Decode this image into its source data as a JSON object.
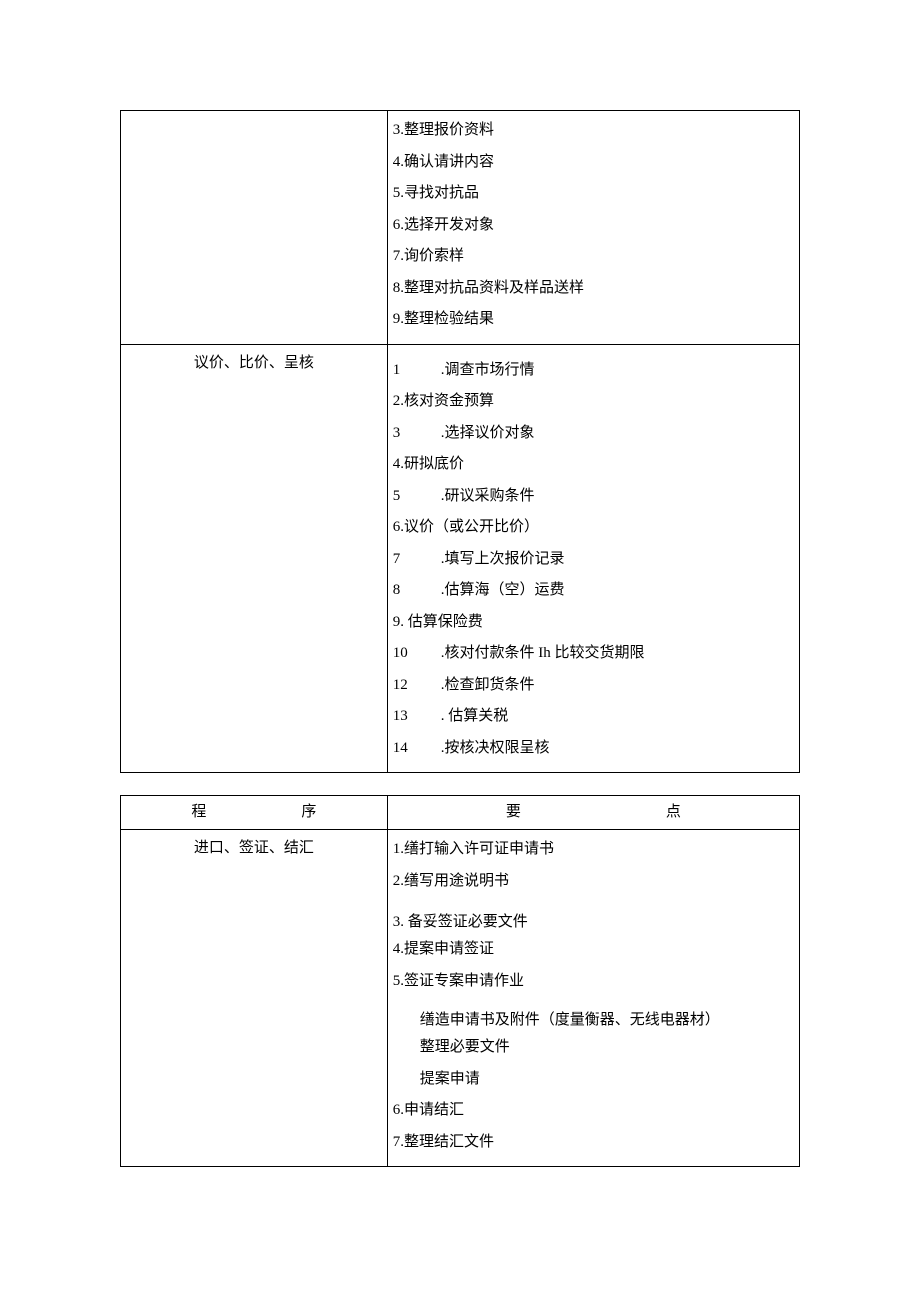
{
  "table1": {
    "rows": [
      {
        "left": "",
        "right": [
          {
            "n": "3",
            "t": ".整理报价资料",
            "wide": false
          },
          {
            "n": "4",
            "t": ".确认请讲内容",
            "wide": false
          },
          {
            "n": "5",
            "t": ".寻找对抗品",
            "wide": false
          },
          {
            "n": "6",
            "t": ".选择开发对象",
            "wide": false
          },
          {
            "n": "7",
            "t": ".询价索样",
            "wide": false
          },
          {
            "n": "8",
            "t": ".整理对抗品资料及样品送样",
            "wide": false
          },
          {
            "n": "9",
            "t": ".整理检验结果",
            "wide": false
          }
        ]
      },
      {
        "left": "议价、比价、呈核",
        "right": [
          {
            "n": "1",
            "t": ".调查市场行情",
            "wide": true
          },
          {
            "n": "2",
            "t": ".核对资金预算",
            "wide": false
          },
          {
            "n": "3",
            "t": ".选择议价对象",
            "wide": true
          },
          {
            "n": "4",
            "t": ".研拟底价",
            "wide": false
          },
          {
            "n": "5",
            "t": ".研议采购条件",
            "wide": true
          },
          {
            "n": "6",
            "t": ".议价（或公开比价）",
            "wide": false
          },
          {
            "n": "7",
            "t": ".填写上次报价记录",
            "wide": true
          },
          {
            "n": "8",
            "t": ".估算海（空）运费",
            "wide": true
          },
          {
            "n": "9",
            "t": ". 估算保险费",
            "wide": false
          },
          {
            "n": "10",
            "t": ".核对付款条件 Ih 比较交货期限",
            "wide": true
          },
          {
            "n": "12",
            "t": ".检查卸货条件",
            "wide": true
          },
          {
            "n": "13",
            "t": ". 估算关税",
            "wide": true
          },
          {
            "n": "14",
            "t": ".按核决权限呈核",
            "wide": true
          }
        ]
      }
    ]
  },
  "table2": {
    "header": {
      "left1": "程",
      "left2": "序",
      "right1": "要",
      "right2": "点"
    },
    "row": {
      "left": "进口、签证、结汇",
      "right": [
        {
          "type": "item",
          "n": "1",
          "t": ".缮打输入许可证申请书"
        },
        {
          "type": "item",
          "n": "2",
          "t": ".缮写用途说明书"
        },
        {
          "type": "itemgap",
          "n": "3",
          "t": ". 备妥签证必要文件"
        },
        {
          "type": "item",
          "n": "4",
          "t": ".提案申请签证"
        },
        {
          "type": "item",
          "n": "5",
          "t": ".签证专案申请作业"
        },
        {
          "type": "sub",
          "t": "缮造申请书及附件（度量衡器、无线电器材）"
        },
        {
          "type": "subtight",
          "t": "整理必要文件"
        },
        {
          "type": "sub",
          "t": "提案申请"
        },
        {
          "type": "item",
          "n": "6",
          "t": ".申请结汇"
        },
        {
          "type": "item",
          "n": "7",
          "t": ".整理结汇文件"
        }
      ]
    }
  }
}
